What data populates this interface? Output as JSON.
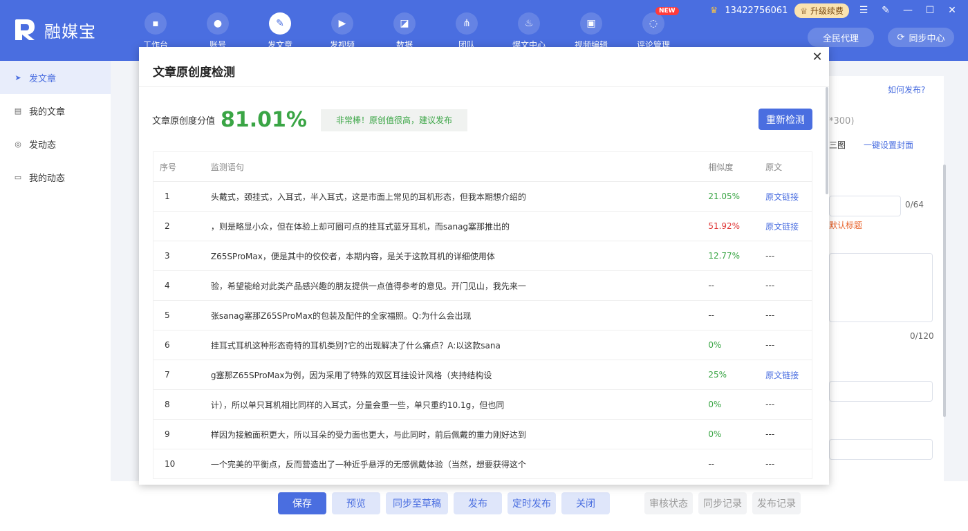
{
  "brand": {
    "name": "融媒宝"
  },
  "nav": [
    {
      "label": "工作台",
      "icon": "monitor-icon",
      "glyph": "▪"
    },
    {
      "label": "账号",
      "icon": "user-icon",
      "glyph": "●"
    },
    {
      "label": "发文章",
      "icon": "feather-icon",
      "glyph": "✎"
    },
    {
      "label": "发视频",
      "icon": "video-icon",
      "glyph": "▶"
    },
    {
      "label": "数据",
      "icon": "chart-icon",
      "glyph": "◪"
    },
    {
      "label": "团队",
      "icon": "team-icon",
      "glyph": "⋔"
    },
    {
      "label": "爆文中心",
      "icon": "fire-icon",
      "glyph": "♨"
    },
    {
      "label": "视频编辑",
      "icon": "briefcase-icon",
      "glyph": "▣"
    },
    {
      "label": "评论管理",
      "icon": "comment-icon",
      "glyph": "◌",
      "badge": "NEW"
    }
  ],
  "user": {
    "phone": "13422756061",
    "upgrade": "升级续费"
  },
  "header_buttons": {
    "agent": "全民代理",
    "sync": "同步中心"
  },
  "sidebar": [
    {
      "label": "发文章",
      "icon": "send-icon",
      "glyph": "➤"
    },
    {
      "label": "我的文章",
      "icon": "document-icon",
      "glyph": "▤"
    },
    {
      "label": "发动态",
      "icon": "circle-icon",
      "glyph": "◎"
    },
    {
      "label": "我的动态",
      "icon": "message-icon",
      "glyph": "▭"
    }
  ],
  "background": {
    "how_to_publish": "如何发布?",
    "size_hint": "*300)",
    "three_img": "三图",
    "cover_setting": "一键设置封面",
    "title_count": "0/64",
    "default_title": "默认标题",
    "desc_count": "0/120"
  },
  "footer": {
    "save": "保存",
    "preview": "预览",
    "sync_draft": "同步至草稿",
    "publish": "发布",
    "schedule": "定时发布",
    "close": "关闭",
    "review_status": "审核状态",
    "sync_record": "同步记录",
    "publish_record": "发布记录"
  },
  "modal": {
    "title": "文章原创度检测",
    "score_label": "文章原创度分值",
    "score": "81.01%",
    "tag": "非常棒！原创值很高，建议发布",
    "recheck": "重新检测",
    "headers": {
      "index": "序号",
      "sentence": "监测语句",
      "similarity": "相似度",
      "source": "原文"
    },
    "rows": [
      {
        "index": "1",
        "sentence": "头戴式，颈挂式，入耳式，半入耳式，这是市面上常见的耳机形态，但我本期想介绍的",
        "similarity": "21.05%",
        "level": "g",
        "source": "原文链接"
      },
      {
        "index": "2",
        "sentence": "，则是略显小众，但在体验上却可圈可点的挂耳式蓝牙耳机，而sanag塞那推出的",
        "similarity": "51.92%",
        "level": "r",
        "source": "原文链接"
      },
      {
        "index": "3",
        "sentence": "Z65SProMax，便是其中的佼佼者，本期内容，是关于这款耳机的详细使用体",
        "similarity": "12.77%",
        "level": "g",
        "source": "---"
      },
      {
        "index": "4",
        "sentence": "验，希望能给对此类产品感兴趣的朋友提供一点值得参考的意见。开门见山，我先来一",
        "similarity": "--",
        "level": "",
        "source": "---"
      },
      {
        "index": "5",
        "sentence": "张sanag塞那Z65SProMax的包装及配件的全家福照。Q:为什么会出现",
        "similarity": "--",
        "level": "",
        "source": "---"
      },
      {
        "index": "6",
        "sentence": "挂耳式耳机这种形态奇特的耳机类别?它的出现解决了什么痛点？A:以这款sana",
        "similarity": "0%",
        "level": "g",
        "source": "---"
      },
      {
        "index": "7",
        "sentence": "g塞那Z65SProMax为例，因为采用了特殊的双区耳挂设计风格（夹持结构设",
        "similarity": "25%",
        "level": "g",
        "source": "原文链接"
      },
      {
        "index": "8",
        "sentence": "计），所以单只耳机相比同样的入耳式，分量会重一些，单只重约10.1g，但也同",
        "similarity": "0%",
        "level": "g",
        "source": "---"
      },
      {
        "index": "9",
        "sentence": "样因为接触面积更大，所以耳朵的受力面也更大，与此同时，前后佩戴的重力刚好达到",
        "similarity": "0%",
        "level": "g",
        "source": "---"
      },
      {
        "index": "10",
        "sentence": "一个完美的平衡点，反而营造出了一种近乎悬浮的无感佩戴体验（当然，想要获得这个",
        "similarity": "--",
        "level": "",
        "source": "---"
      }
    ]
  }
}
